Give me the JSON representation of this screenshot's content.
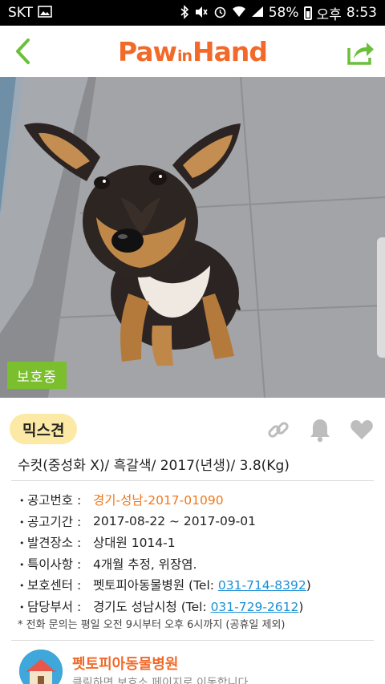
{
  "status_bar": {
    "carrier": "SKT",
    "battery_percent": "58%",
    "ampm": "오후",
    "time": "8:53",
    "icons": [
      "image-icon",
      "bluetooth-icon",
      "mute-icon",
      "alarm-icon",
      "wifi-icon",
      "signal-icon",
      "battery-icon"
    ]
  },
  "header": {
    "logo_text_1": "Paw",
    "logo_text_2": "in",
    "logo_text_3": "Hand",
    "brand_color": "#f26a2a",
    "accent_color": "#6cbf3a"
  },
  "photo": {
    "status_tag": "보호중"
  },
  "pet": {
    "breed": "믹스견",
    "summary": "수컷(중성화 X)/ 흑갈색/ 2017(년생)/ 3.8(Kg)"
  },
  "details": [
    {
      "label": "공고번호 :",
      "value": "경기-성남-2017-01090",
      "highlight": true
    },
    {
      "label": "공고기간 :",
      "value": "2017-08-22 ~ 2017-09-01"
    },
    {
      "label": "발견장소 :",
      "value": "상대원 1014-1"
    },
    {
      "label": "특이사항 :",
      "value": "4개월 추정, 위장염."
    }
  ],
  "center": {
    "label": "보호센터 :",
    "name": "펫토피아동물병원",
    "tel_prefix": "(Tel: ",
    "tel": "031-714-8392",
    "tel_suffix": ")"
  },
  "department": {
    "label": "담당부서 :",
    "name": "경기도 성남시청",
    "tel_prefix": "(Tel: ",
    "tel": "031-729-2612",
    "tel_suffix": ")"
  },
  "note": "* 전화 문의는 평일 오전 9시부터 오후 6시까지 (공휴일 제외)",
  "shelter_card": {
    "name": "펫토피아동물병원",
    "subtitle": "클릭하면 보호소 페이지로 이동합니다"
  }
}
